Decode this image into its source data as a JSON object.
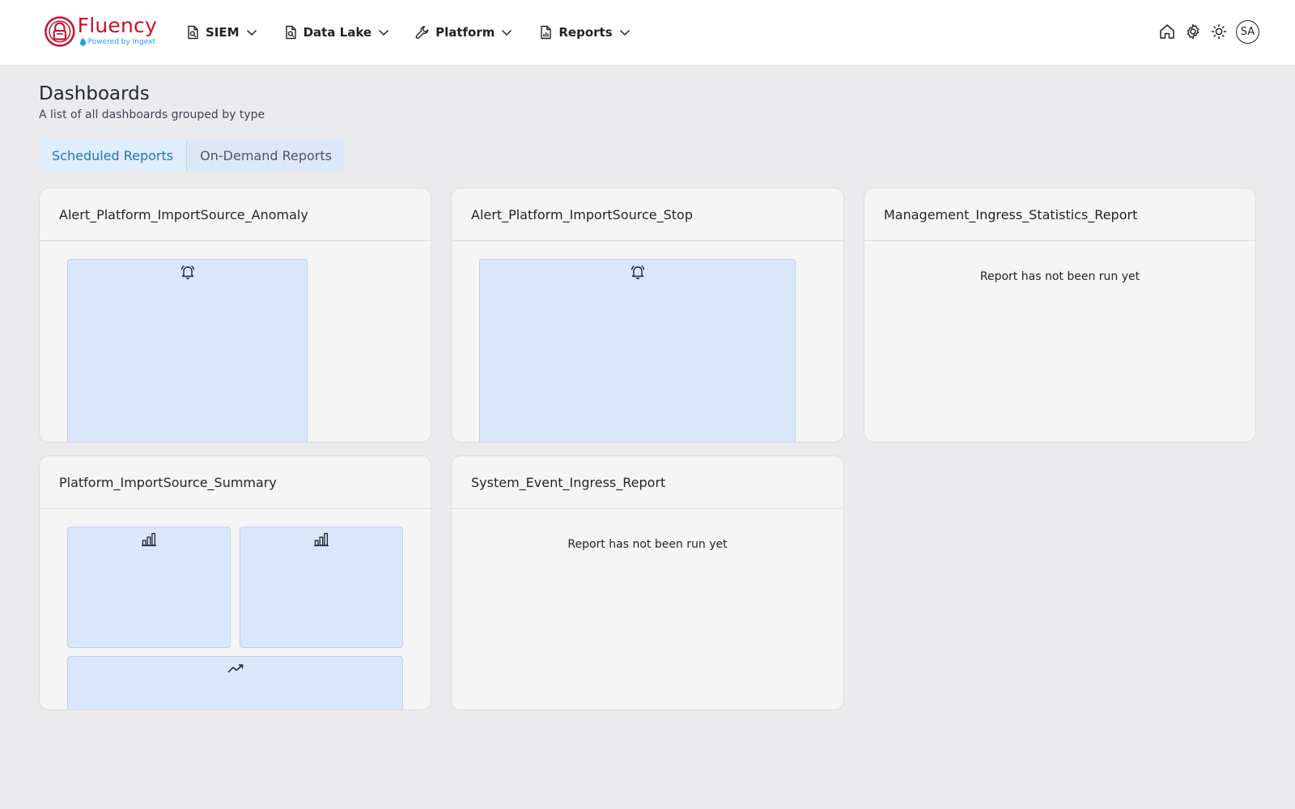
{
  "brand": {
    "name": "Fluency",
    "tagline": "Powered by Ingext",
    "color": "#c8102e",
    "tagline_color": "#2b9be0"
  },
  "nav": {
    "items": [
      {
        "label": "SIEM",
        "icon": "file-search-icon"
      },
      {
        "label": "Data Lake",
        "icon": "file-search-icon"
      },
      {
        "label": "Platform",
        "icon": "wrench-icon"
      },
      {
        "label": "Reports",
        "icon": "file-chart-icon"
      }
    ],
    "right_icons": [
      "home-icon",
      "gear-icon",
      "sun-icon"
    ],
    "avatar_initials": "SA"
  },
  "page": {
    "title": "Dashboards",
    "subtitle": "A list of all dashboards grouped by type"
  },
  "tabs": [
    {
      "label": "Scheduled Reports",
      "active": true
    },
    {
      "label": "On-Demand Reports",
      "active": false
    }
  ],
  "cards": [
    {
      "title": "Alert_Platform_ImportSource_Anomaly",
      "status": "",
      "widgets": [
        "bell-icon"
      ]
    },
    {
      "title": "Alert_Platform_ImportSource_Stop",
      "status": "",
      "widgets": [
        "bell-icon"
      ]
    },
    {
      "title": "Management_Ingress_Statistics_Report",
      "status": "Report has not been run yet",
      "widgets": []
    },
    {
      "title": "Platform_ImportSource_Summary",
      "status": "",
      "widgets": [
        "bar-chart-icon",
        "bar-chart-icon",
        "trend-up-icon"
      ]
    },
    {
      "title": "System_Event_Ingress_Report",
      "status": "Report has not been run yet",
      "widgets": []
    }
  ],
  "colors": {
    "page_bg": "#ebebee",
    "card_bg": "#f5f5f6",
    "widget_bg": "#dae7fb",
    "active_tab_text": "#1d77b3",
    "tab_bg": "#dde8f7"
  }
}
